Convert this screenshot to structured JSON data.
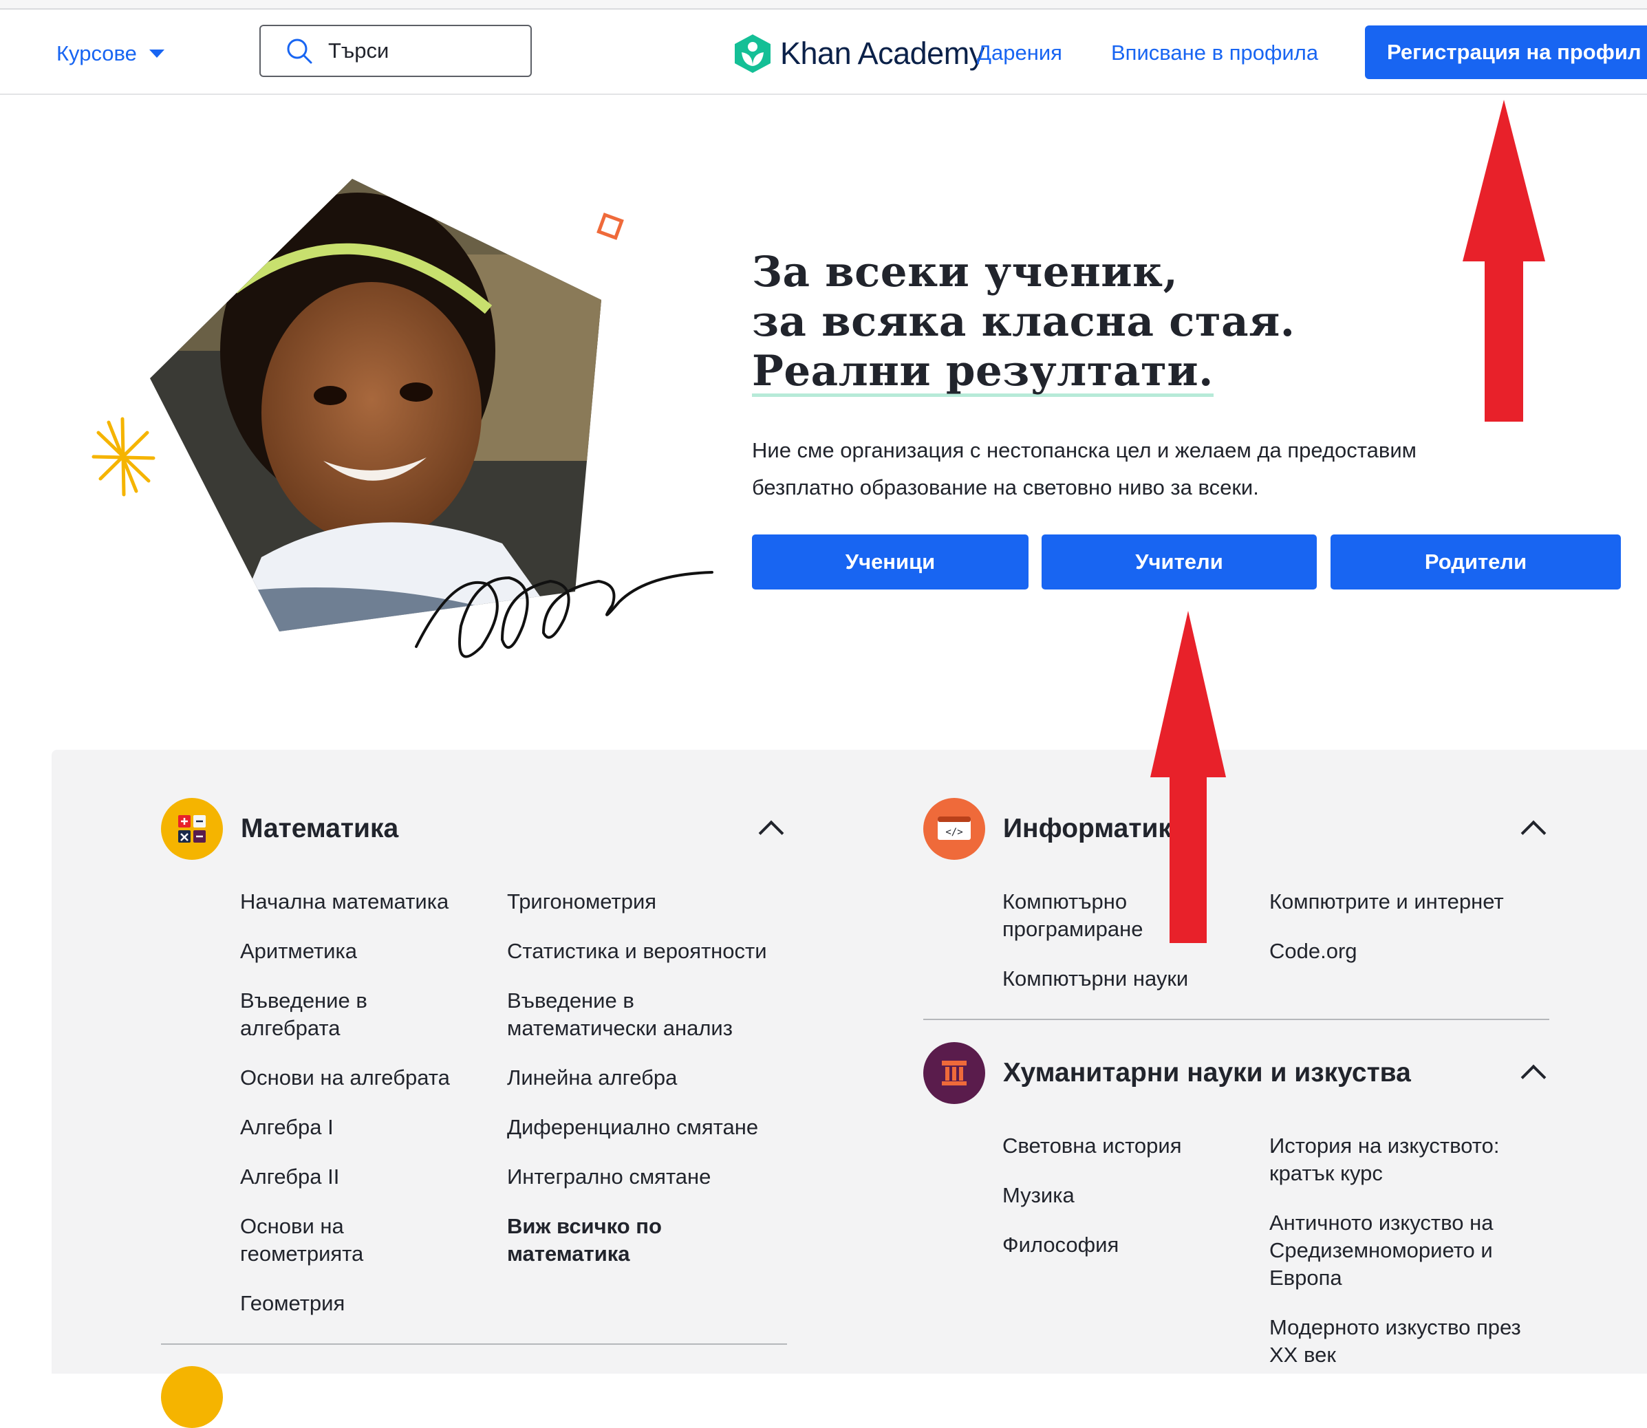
{
  "header": {
    "courses_label": "Курсове",
    "search_placeholder": "Търси",
    "logo_text": "Khan Academy",
    "donate_label": "Дарения",
    "login_label": "Вписване в профила",
    "signup_label": "Регистрация на профил"
  },
  "hero": {
    "title_line1": "За всеки ученик,",
    "title_line2": "за всяка класна стая.",
    "title_line3": "Реални резултати.",
    "desc_line1": "Ние сме организация с нестопанска цел и желаем да предоставим",
    "desc_line2": "безплатно образование на световно ниво за всеки.",
    "buttons": {
      "learners": "Ученици",
      "teachers": "Учители",
      "parents": "Родители"
    }
  },
  "math": {
    "title": "Математика",
    "col1": [
      "Начална математика",
      "Аритметика",
      "Въведение в алгебрата",
      "Основи на алгебрата",
      "Алгебра I",
      "Алгебра II",
      "Основи на геометрията",
      "Геометрия"
    ],
    "col2": [
      "Тригонометрия",
      "Статистика и вероятности",
      "Въведение в математически анализ",
      "Линейна алгебра",
      "Диференциално смятане",
      "Интегрално смятане"
    ],
    "see_all": "Виж всичко по математика"
  },
  "computing": {
    "title": "Информатика",
    "col1": [
      "Компютърно програмиране",
      "Компютърни науки"
    ],
    "col2": [
      "Компютрите и интернет",
      "Code.org"
    ]
  },
  "humanities": {
    "title": "Хуманитарни науки и изкуства",
    "col1": [
      "Световна история",
      "Музика",
      "Философия"
    ],
    "col2": [
      "История на изкуството: кратък курс",
      "Античното изкуство на Средиземноморието и Европа",
      "Модерното изкуство през XX век"
    ]
  },
  "colors": {
    "primary": "#1865f2",
    "math_icon": "#f5b400",
    "computing_icon": "#ef6a3a",
    "humanities_icon": "#5a1c4c",
    "annotation_arrow": "#e8212a"
  },
  "icons": {
    "math": "calculator-icon",
    "computing": "code-window-icon",
    "humanities": "column-icon"
  }
}
